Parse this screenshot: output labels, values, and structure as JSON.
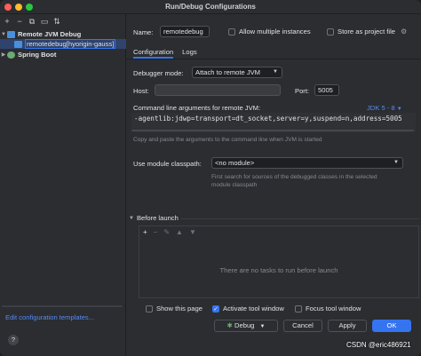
{
  "window": {
    "title": "Run/Debug Configurations"
  },
  "toolbar": {
    "icons": [
      "add-icon",
      "remove-icon",
      "copy-icon",
      "save-icon",
      "sort-icon"
    ]
  },
  "tree": {
    "group1": "Remote JVM Debug",
    "item1": "remotedebug[hyorigin-gauss]",
    "group2": "Spring Boot"
  },
  "left_footer": {
    "edit_templates": "Edit configuration templates..."
  },
  "form": {
    "name_label": "Name:",
    "name_value": "remotedebug",
    "allow_multiple": "Allow multiple instances",
    "store_as_file": "Store as project file",
    "tabs": [
      "Configuration",
      "Logs"
    ],
    "debugger_mode_label": "Debugger mode:",
    "debugger_mode_value": "Attach to remote JVM",
    "host_label": "Host:",
    "host_value": "",
    "port_label": "Port:",
    "port_value": "5005",
    "cmd_label": "Command line arguments for remote JVM:",
    "jdk_link": "JDK 5 - 8",
    "cmd_value": "-agentlib:jdwp=transport=dt_socket,server=y,suspend=n,address=5005",
    "cmd_hint": "Copy and paste the arguments to the command line when JVM is started",
    "module_label": "Use module classpath:",
    "module_value": "<no module>",
    "module_hint1": "First search for sources of the debugged classes in the selected",
    "module_hint2": "module classpath",
    "before_launch": "Before launch",
    "no_tasks": "There are no tasks to run before launch",
    "show_page": "Show this page",
    "activate_tool": "Activate tool window",
    "focus_tool": "Focus tool window"
  },
  "checkbox_states": {
    "allow_multiple": false,
    "store_as_file": false,
    "show_page": false,
    "activate_tool": true,
    "focus_tool": false
  },
  "buttons": {
    "help": "?",
    "debug": "Debug",
    "cancel": "Cancel",
    "apply": "Apply",
    "ok": "OK"
  },
  "watermark": "CSDN @eric486921",
  "colors": {
    "accent": "#3574f0",
    "link": "#548af7",
    "background": "#2b2d30"
  }
}
